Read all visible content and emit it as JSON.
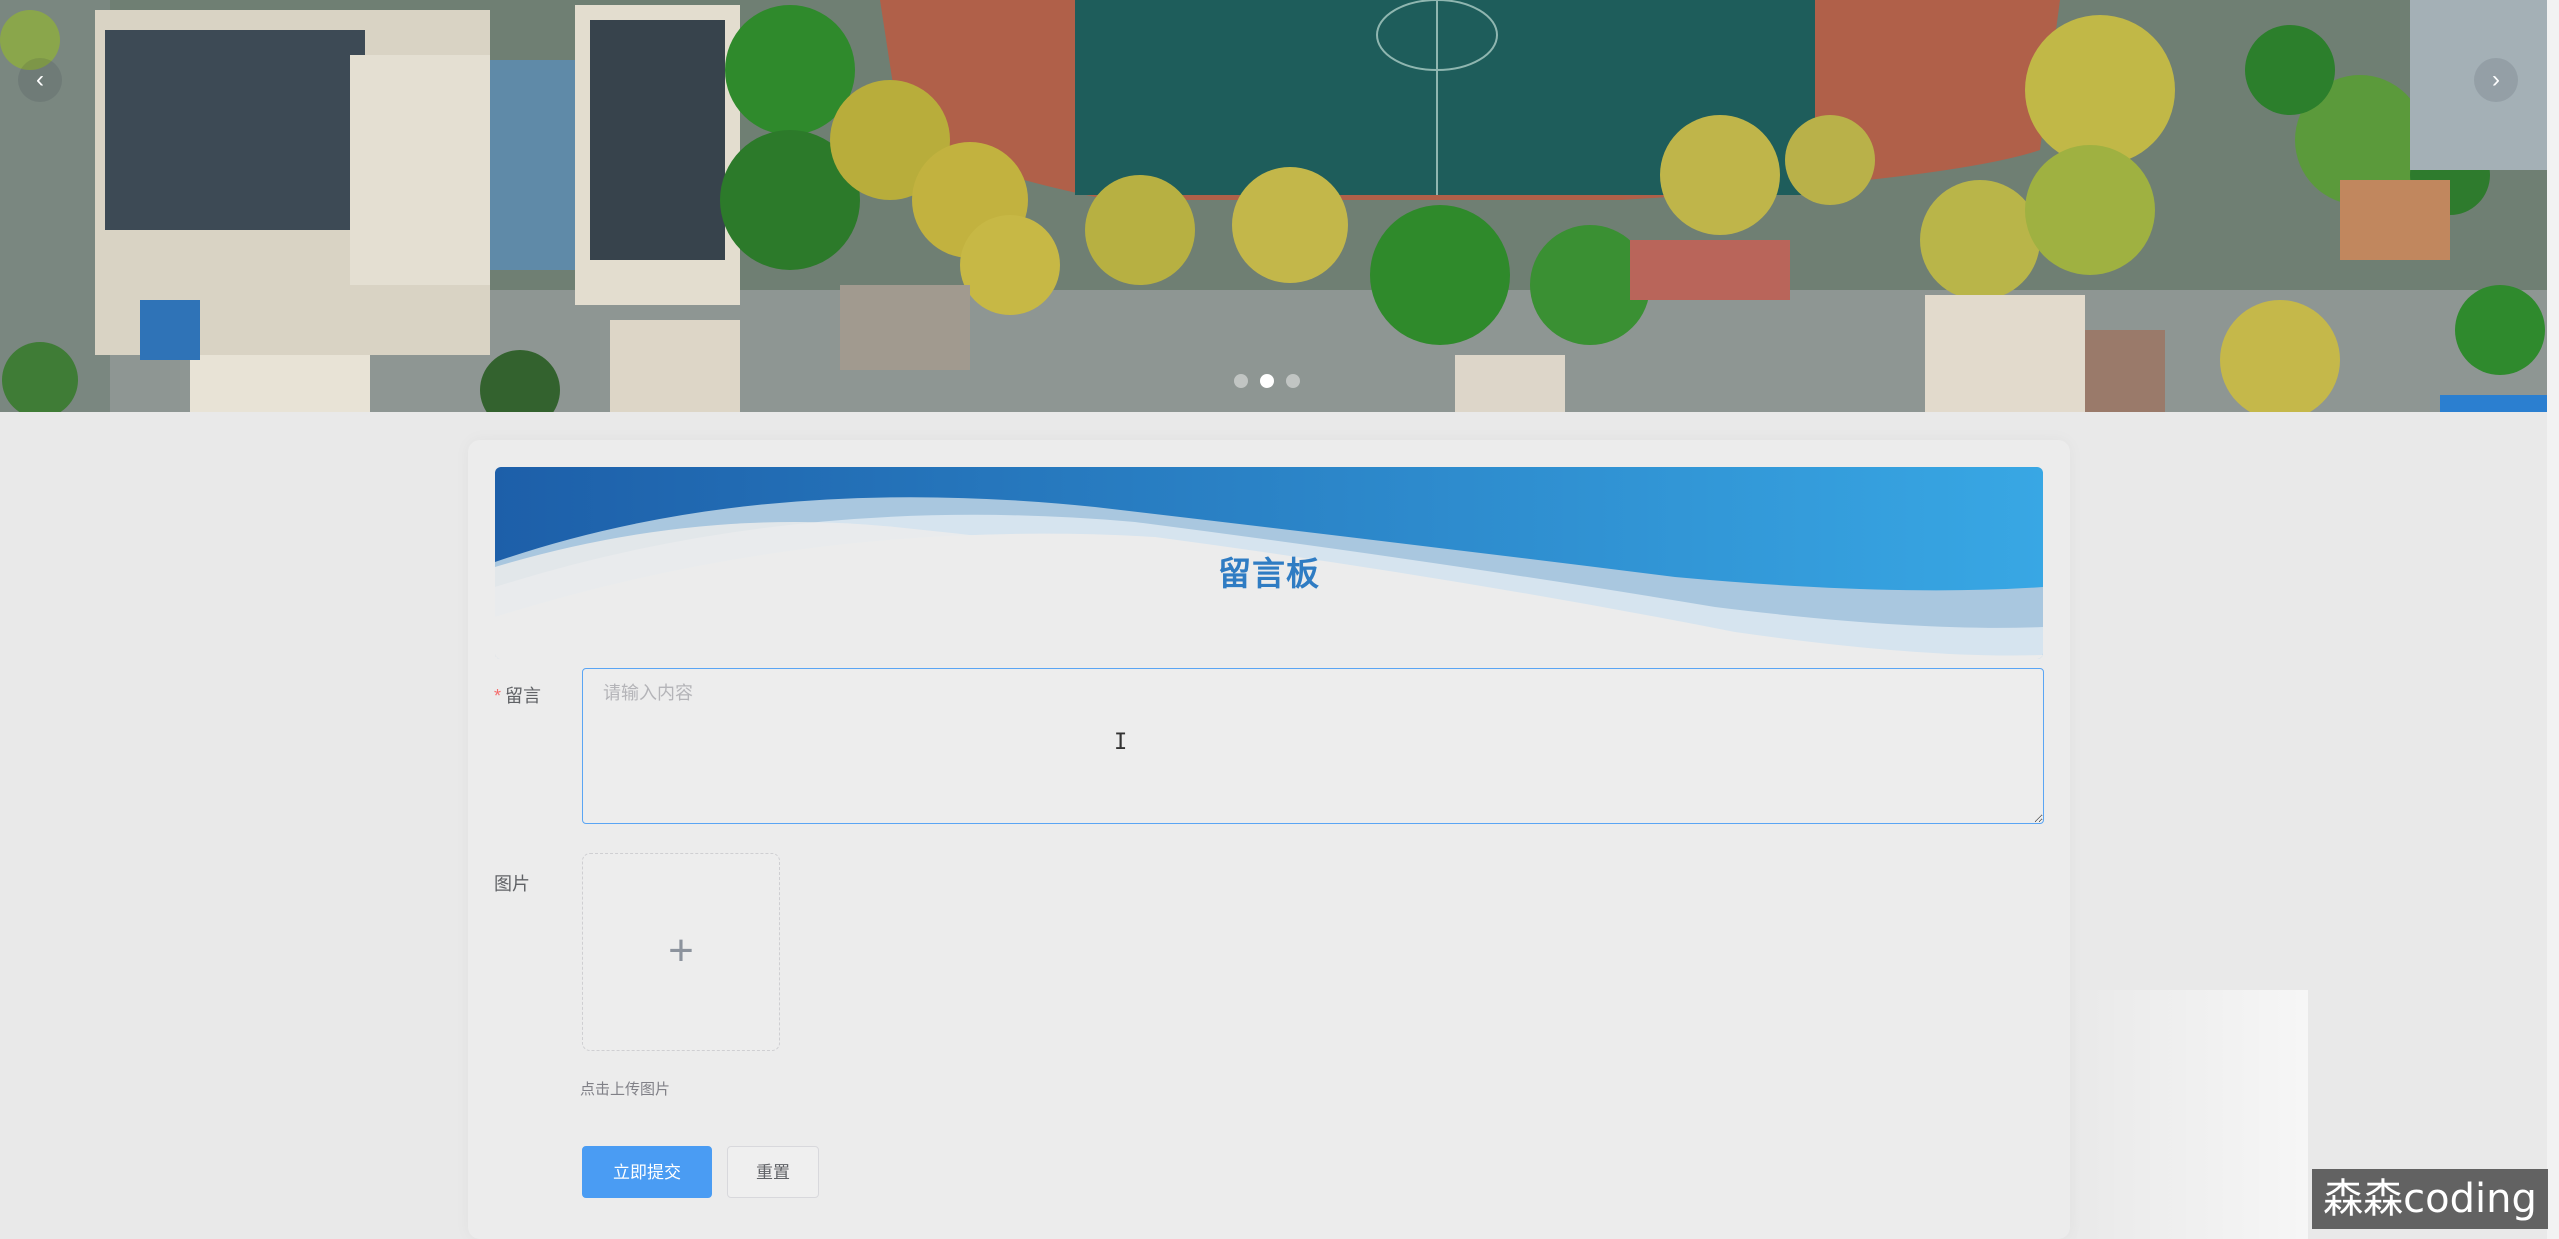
{
  "carousel": {
    "prev_arrow": "‹",
    "next_arrow": "›",
    "slide_count": 3,
    "active_slide": 2,
    "image": "aerial-campus-photo"
  },
  "board": {
    "title": "留言板",
    "message_label": "留言",
    "message_placeholder": "请输入内容",
    "message_value": "",
    "message_required_mark": "*",
    "image_label": "图片",
    "upload_icon": "plus-icon",
    "upload_plus": "+",
    "upload_tip": "点击上传图片",
    "submit_label": "立即提交",
    "reset_label": "重置"
  },
  "text_cursor": "I",
  "watermark": "森森coding",
  "colors": {
    "primary": "#4a9cf3",
    "title": "#2f7cc3",
    "required": "#f56c6c",
    "header_dark": "#1d62ad",
    "header_light": "#37a5e4"
  }
}
